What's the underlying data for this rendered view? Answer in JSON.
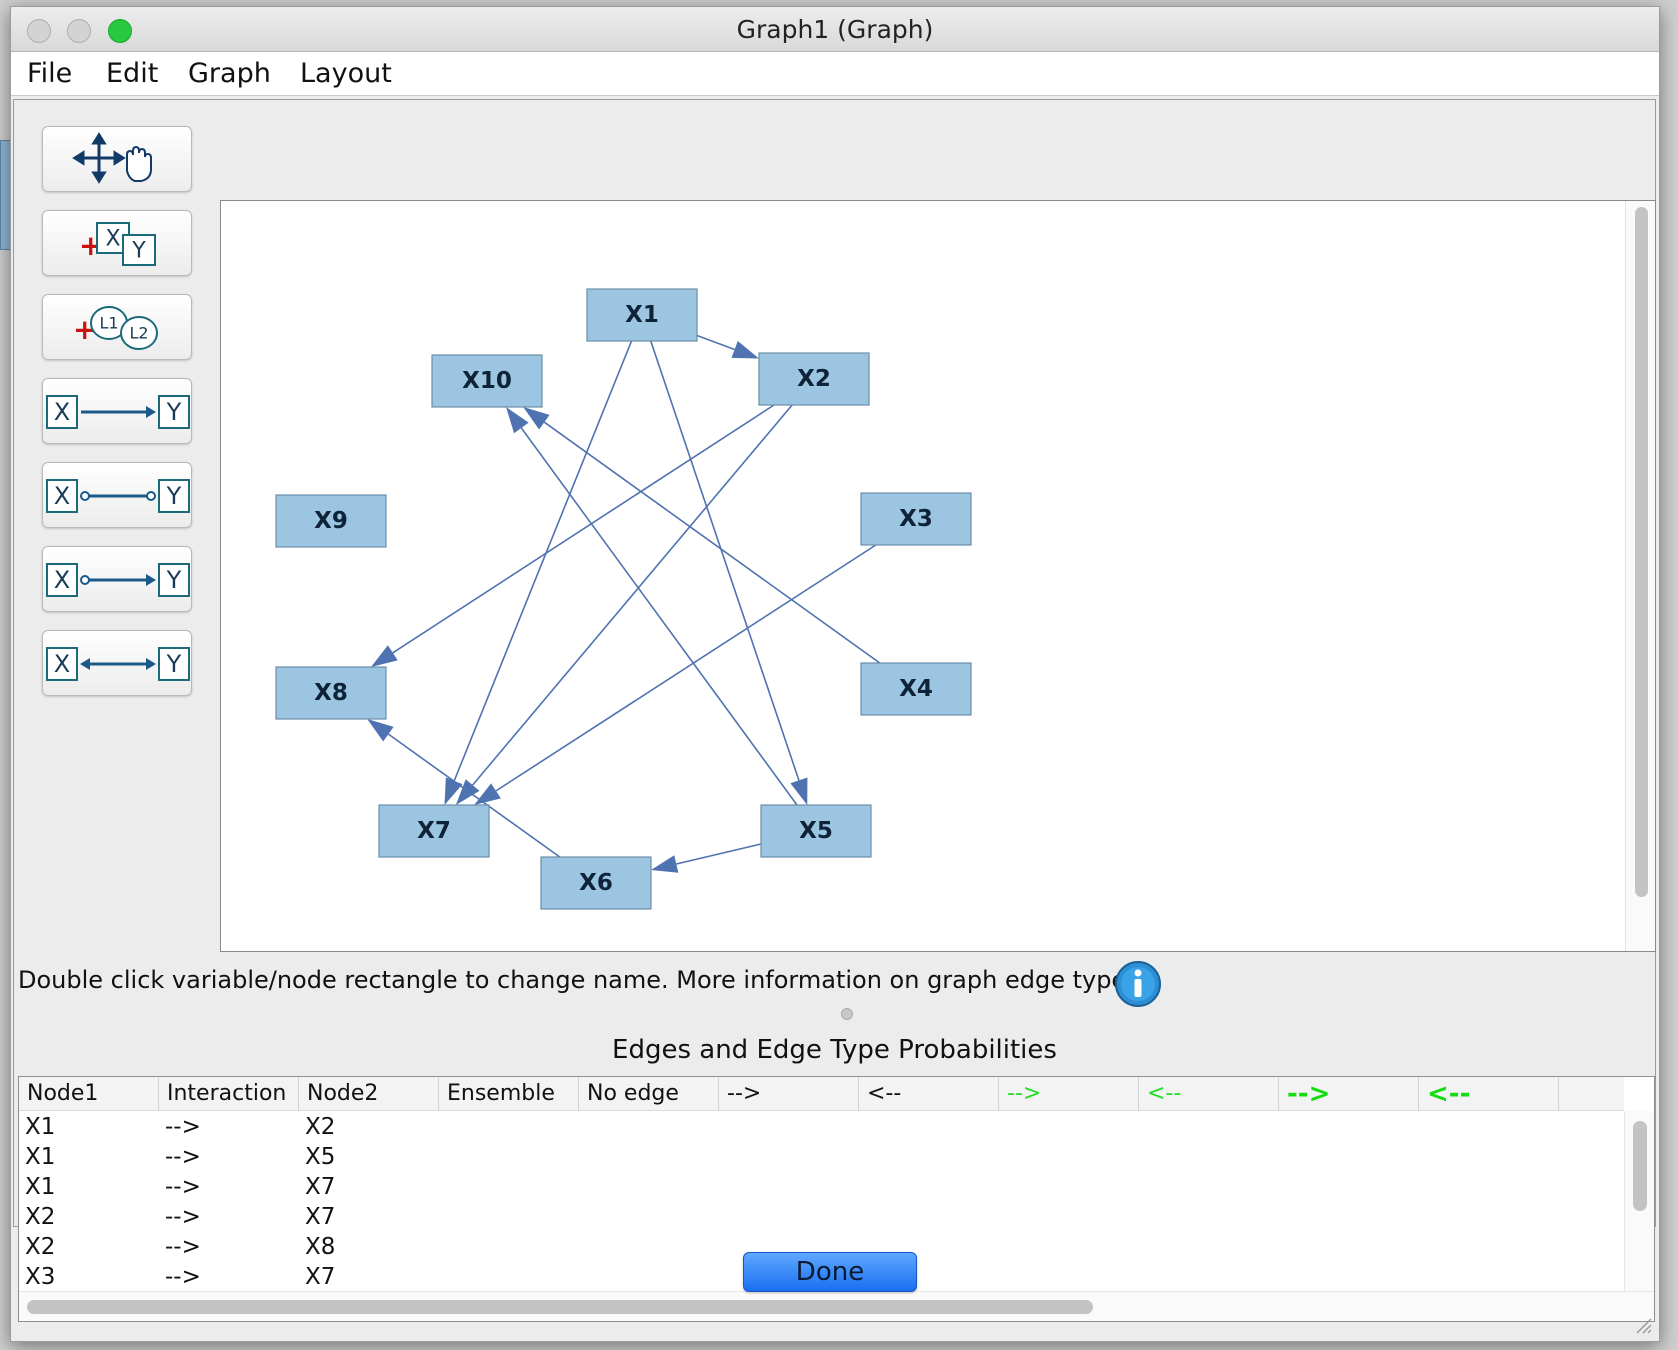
{
  "window": {
    "title": "Graph1 (Graph)"
  },
  "menu": [
    "File",
    "Edit",
    "Graph",
    "Layout"
  ],
  "toolbar": [
    {
      "name": "move-tool-button",
      "icon": "move-hand-icon"
    },
    {
      "name": "add-variable-button",
      "icon": "add-measured-variable-icon",
      "labels": [
        "X",
        "Y"
      ]
    },
    {
      "name": "add-latent-button",
      "icon": "add-latent-variable-icon",
      "labels": [
        "L1",
        "L2"
      ]
    },
    {
      "name": "directed-edge-button",
      "icon": "directed-edge-icon",
      "labels": [
        "X",
        "Y"
      ]
    },
    {
      "name": "undirected-circle-edge-button",
      "icon": "circle-circle-edge-icon",
      "labels": [
        "X",
        "Y"
      ]
    },
    {
      "name": "partially-directed-edge-button",
      "icon": "circle-arrow-edge-icon",
      "labels": [
        "X",
        "Y"
      ]
    },
    {
      "name": "bidirected-edge-button",
      "icon": "bidirected-edge-icon",
      "labels": [
        "X",
        "Y"
      ]
    }
  ],
  "graph": {
    "nodes": [
      {
        "id": "X1",
        "label": "X1"
      },
      {
        "id": "X2",
        "label": "X2"
      },
      {
        "id": "X3",
        "label": "X3"
      },
      {
        "id": "X4",
        "label": "X4"
      },
      {
        "id": "X5",
        "label": "X5"
      },
      {
        "id": "X6",
        "label": "X6"
      },
      {
        "id": "X7",
        "label": "X7"
      },
      {
        "id": "X8",
        "label": "X8"
      },
      {
        "id": "X9",
        "label": "X9"
      },
      {
        "id": "X10",
        "label": "X10"
      }
    ],
    "edges": [
      [
        "X1",
        "X2"
      ],
      [
        "X1",
        "X5"
      ],
      [
        "X1",
        "X7"
      ],
      [
        "X2",
        "X7"
      ],
      [
        "X2",
        "X8"
      ],
      [
        "X3",
        "X7"
      ],
      [
        "X4",
        "X10"
      ],
      [
        "X5",
        "X10"
      ],
      [
        "X5",
        "X6"
      ],
      [
        "X6",
        "X8"
      ]
    ],
    "edge_color": "#4f72b0"
  },
  "info": {
    "text": "Double click variable/node rectangle to change name. More information on graph edge types"
  },
  "table": {
    "title": "Edges and Edge Type Probabilities",
    "columns": [
      {
        "label": "Node1",
        "color": "#111111"
      },
      {
        "label": "Interaction",
        "color": "#111111"
      },
      {
        "label": "Node2",
        "color": "#111111"
      },
      {
        "label": "Ensemble",
        "color": "#111111"
      },
      {
        "label": "No edge",
        "color": "#111111"
      },
      {
        "label": "-->",
        "color": "#111111"
      },
      {
        "label": "<--",
        "color": "#111111"
      },
      {
        "label": "-->",
        "color": "#22dd22"
      },
      {
        "label": "<--",
        "color": "#22dd22"
      },
      {
        "label": "-->",
        "color": "#11dd11",
        "bold": true
      },
      {
        "label": "<--",
        "color": "#11dd11",
        "bold": true
      }
    ],
    "rows": [
      [
        "X1",
        "-->",
        "X2"
      ],
      [
        "X1",
        "-->",
        "X5"
      ],
      [
        "X1",
        "-->",
        "X7"
      ],
      [
        "X2",
        "-->",
        "X7"
      ],
      [
        "X2",
        "-->",
        "X8"
      ],
      [
        "X3",
        "-->",
        "X7"
      ]
    ]
  },
  "buttons": {
    "done": "Done"
  },
  "colors": {
    "node_fill": "#9cc5e2",
    "done_button": "#1a6ff0",
    "accent_green": "#22dd22"
  }
}
